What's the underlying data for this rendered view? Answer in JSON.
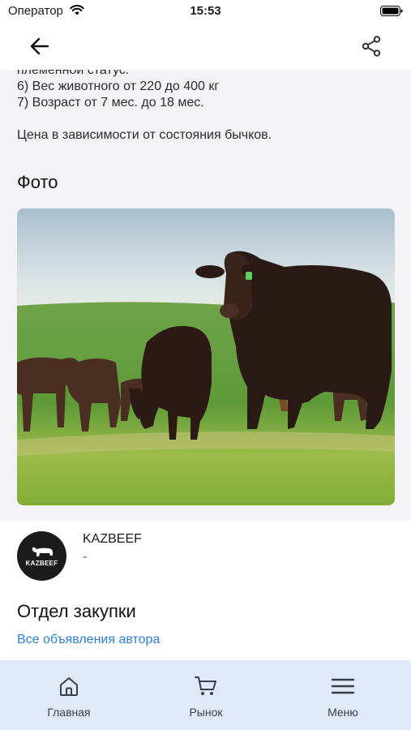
{
  "status_bar": {
    "carrier": "Оператор",
    "time": "15:53"
  },
  "nav": {
    "back_icon": "arrow-left-icon",
    "share_icon": "share-icon"
  },
  "description": {
    "lines": [
      "племенной статус.",
      "6) Вес животного от 220 до 400 кг",
      "7) Возраст от 7 мес. до 18 мес."
    ],
    "price_note": "Цена в зависимости от состояния бычков."
  },
  "photo_section": {
    "title": "Фото"
  },
  "author": {
    "avatar_text": "KAZBEEF",
    "name": "KAZBEEF",
    "subtitle": "-",
    "department": "Отдел закупки",
    "all_listings_link": "Все объявления автора"
  },
  "tab_bar": {
    "items": [
      {
        "label": "Главная",
        "icon": "home-icon"
      },
      {
        "label": "Рынок",
        "icon": "cart-icon"
      },
      {
        "label": "Меню",
        "icon": "menu-icon"
      }
    ]
  },
  "colors": {
    "link": "#2f80d0",
    "tab_bar_bg": "#dfe9f8",
    "content_bg": "#f3f3f5"
  }
}
